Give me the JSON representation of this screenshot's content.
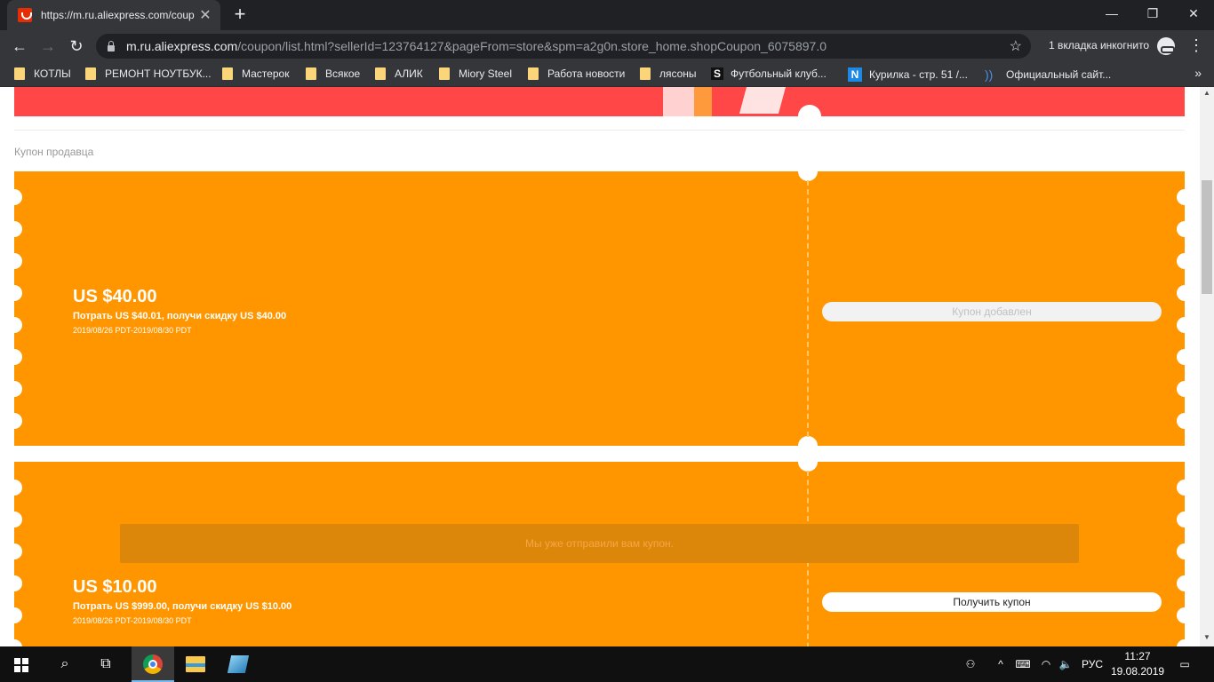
{
  "browser": {
    "tab_title": "https://m.ru.aliexpress.com/coup",
    "url_host": "m.ru.aliexpress.com",
    "url_path": "/coupon/list.html?sellerId=123764127&pageFrom=store&spm=a2g0n.store_home.shopCoupon_6075897.0",
    "incognito_label": "1 вкладка инкогнито",
    "bookmarks": [
      {
        "label": "КОТЛЫ",
        "icon": "folder-icon"
      },
      {
        "label": "РЕМОНТ НОУТБУК...",
        "icon": "folder-icon"
      },
      {
        "label": "Мастерок",
        "icon": "folder-icon"
      },
      {
        "label": "Всякое",
        "icon": "folder-icon"
      },
      {
        "label": "АЛИК",
        "icon": "folder-icon"
      },
      {
        "label": "Miory Steel",
        "icon": "folder-icon"
      },
      {
        "label": "Работа новости",
        "icon": "folder-icon"
      },
      {
        "label": "лясоны",
        "icon": "folder-icon"
      },
      {
        "label": "Футбольный клуб...",
        "icon": "site-s-icon"
      },
      {
        "label": "Курилка - стр. 51 /...",
        "icon": "site-n-icon"
      },
      {
        "label": "Официальный сайт...",
        "icon": "rss-icon"
      }
    ]
  },
  "page": {
    "section_label": "Купон продавца",
    "coupons": [
      {
        "amount": "US $40.00",
        "condition": "Потрать US $40.01, получи скидку US $40.00",
        "dates": "2019/08/26 PDT-2019/08/30 PDT",
        "button_label": "Купон добавлен"
      },
      {
        "amount": "US $10.00",
        "condition": "Потрать US $999.00, получи скидку US $10.00",
        "dates": "2019/08/26 PDT-2019/08/30 PDT",
        "button_label": "Получить купон"
      }
    ],
    "toast": "Мы уже отправили вам купон."
  },
  "taskbar": {
    "language": "РУС",
    "time": "11:27",
    "date": "19.08.2019"
  },
  "colors": {
    "coupon_orange": "#ff9600",
    "brand_red": "#ff4747"
  }
}
